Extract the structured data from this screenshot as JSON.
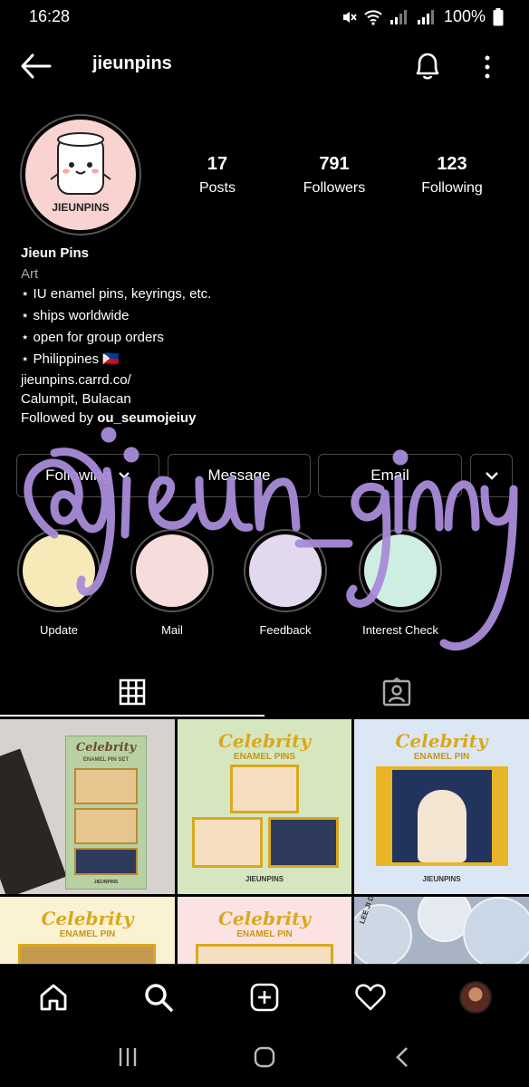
{
  "status_bar": {
    "time": "16:28",
    "battery": "100%"
  },
  "header": {
    "username": "jieunpins"
  },
  "profile": {
    "avatar_text": "JIEUNPINS",
    "stats": [
      {
        "value": "17",
        "label": "Posts"
      },
      {
        "value": "791",
        "label": "Followers"
      },
      {
        "value": "123",
        "label": "Following"
      }
    ],
    "name": "Jieun Pins",
    "category": "Art",
    "bio_lines": [
      "⋆ IU enamel pins, keyrings, etc.",
      "⋆ ships worldwide",
      "⋆ open for group orders",
      "⋆ Philippines 🇵🇭"
    ],
    "website": "jieunpins.carrd.co/",
    "location": "Calumpit, Bulacan",
    "followed_by_prefix": "Followed by ",
    "followed_by_user": "ou_seumojeiuy"
  },
  "actions": {
    "following": "Following",
    "message": "Message",
    "email": "Email"
  },
  "highlights": [
    {
      "label": "Update",
      "color": "#f6eab9"
    },
    {
      "label": "Mail",
      "color": "#f7dcdc"
    },
    {
      "label": "Feedback",
      "color": "#e2d9ef"
    },
    {
      "label": "Interest Check",
      "color": "#cfeee2"
    }
  ],
  "overlay_text": "@jieun_ginny",
  "grid": {
    "tile2": {
      "title": "Celebrity",
      "sub": "ENAMEL PINS",
      "brand": "JIEUNPINS"
    },
    "tile3": {
      "title": "Celebrity",
      "sub": "ENAMEL PIN",
      "brand": "JIEUNPINS"
    },
    "tile1": {
      "title": "Celebrity",
      "sub": "ENAMEL PIN SET",
      "brand": "JIEUNPINS"
    },
    "tile4": {
      "title": "Celebrity",
      "sub": "ENAMEL PIN"
    },
    "tile5": {
      "title": "Celebrity",
      "sub": "ENAMEL PIN"
    },
    "tile6": {
      "button_text": "LEE JI DONG"
    }
  },
  "icons": [
    "back-arrow-icon",
    "bell-icon",
    "more-vertical-icon",
    "chevron-down-icon",
    "grid-icon",
    "tagged-icon",
    "home-icon",
    "search-icon",
    "add-icon",
    "heart-icon"
  ],
  "colors": {
    "background": "#000000",
    "border": "#4a4a4a",
    "scribble": "#a98cd8",
    "accent_gold": "#d9a81e"
  }
}
